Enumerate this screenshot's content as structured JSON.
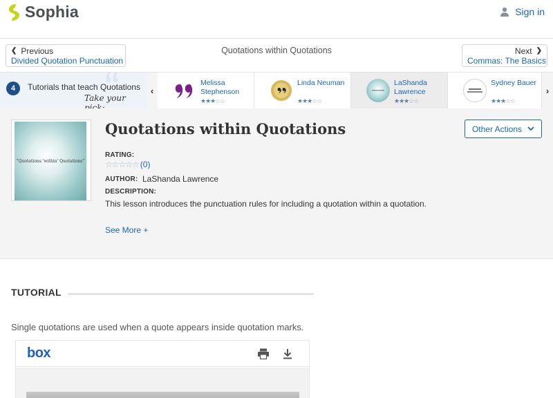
{
  "header": {
    "logo_text": "Sophia",
    "signin_label": "Sign in",
    "brand_color": "#c3d61c",
    "link_color": "#1a66b8"
  },
  "nav": {
    "prev_dir": "Previous",
    "prev_title": "Divided Quotation Punctuation",
    "center_title": "Quotations within Quotations",
    "next_dir": "Next",
    "next_title": "Commas: The Basics"
  },
  "carousel": {
    "count": "4",
    "label": "Tutorials that teach Quotations",
    "pick_text": "Take your pick:",
    "cards": [
      {
        "name": "Melissa Stephenson",
        "stars": 3
      },
      {
        "name": "Linda Neuman",
        "stars": 3
      },
      {
        "name": "LaShanda Lawrence",
        "stars": 3
      },
      {
        "name": "Sydney Bauer",
        "stars": 3
      }
    ]
  },
  "lesson": {
    "thumb_text": "\"Quotations 'within' Quotations\"",
    "title": "Quotations within Quotations",
    "other_actions_label": "Other Actions",
    "rating_label": "RATING:",
    "rating_count": "(0)",
    "author_label": "AUTHOR:",
    "author_name": "LaShanda Lawrence",
    "description_label": "DESCRIPTION:",
    "description": "This lesson introduces the punctuation rules for including a quotation within a quotation.",
    "see_more_label": "See More +"
  },
  "tutorial": {
    "heading": "TUTORIAL",
    "intro": "Single quotations are used when a quote appears inside quotation marks."
  },
  "viewer": {
    "logo": "box",
    "print_icon": "print-icon",
    "download_icon": "download-icon"
  }
}
